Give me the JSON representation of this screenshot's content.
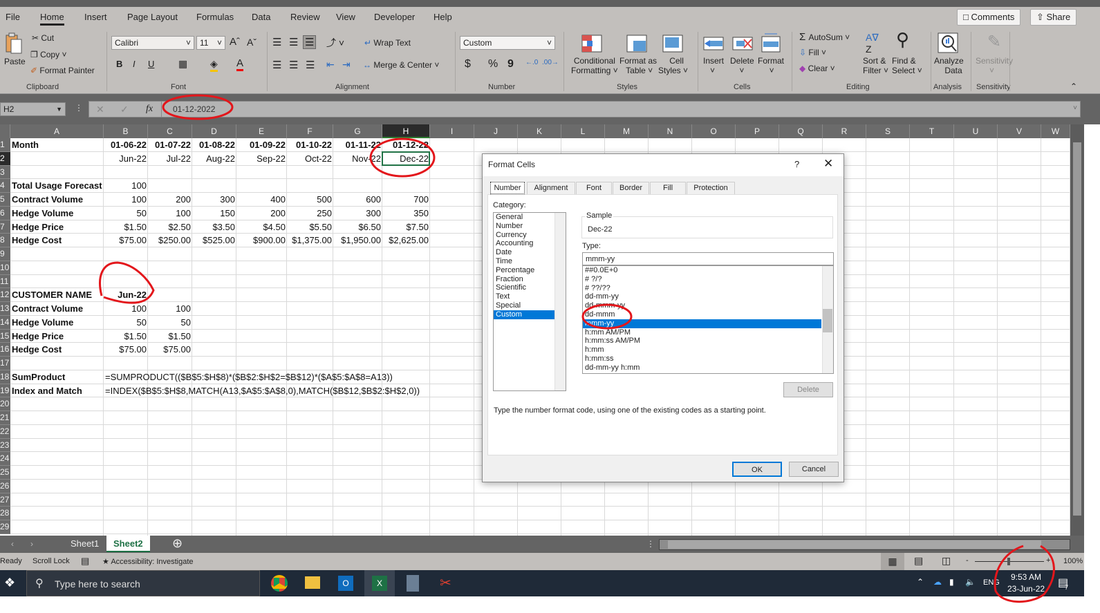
{
  "ribbon": {
    "tabs": [
      "File",
      "Home",
      "Insert",
      "Page Layout",
      "Formulas",
      "Data",
      "Review",
      "View",
      "Developer",
      "Help"
    ],
    "active_tab": "Home",
    "comments": "Comments",
    "share": "Share",
    "clipboard": {
      "paste": "Paste",
      "cut": "Cut",
      "copy": "Copy",
      "format_painter": "Format Painter",
      "group": "Clipboard"
    },
    "font": {
      "name": "Calibri",
      "size": "11",
      "bold": "B",
      "italic": "I",
      "underline": "U",
      "group": "Font"
    },
    "alignment": {
      "wrap": "Wrap Text",
      "merge": "Merge & Center",
      "group": "Alignment"
    },
    "number": {
      "format": "Custom",
      "currency": "$",
      "percent": "%",
      "comma": "9",
      "group": "Number"
    },
    "styles": {
      "conditional": "Conditional",
      "conditional2": "Formatting",
      "format_table": "Format as",
      "format_table2": "Table",
      "cell_styles": "Cell",
      "cell_styles2": "Styles",
      "group": "Styles"
    },
    "cells": {
      "insert": "Insert",
      "delete": "Delete",
      "format": "Format",
      "group": "Cells"
    },
    "editing": {
      "autosum": "AutoSum",
      "fill": "Fill",
      "clear": "Clear",
      "sort": "Sort &",
      "sort2": "Filter",
      "find": "Find &",
      "find2": "Select",
      "group": "Editing"
    },
    "analysis": {
      "analyze": "Analyze",
      "analyze2": "Data",
      "group": "Analysis"
    },
    "sensitivity": {
      "label": "Sensitivity",
      "group": "Sensitivity"
    }
  },
  "formula_bar": {
    "name_box": "H2",
    "value": "01-12-2022",
    "fx": "fx"
  },
  "grid": {
    "columns": [
      "A",
      "B",
      "C",
      "D",
      "E",
      "F",
      "G",
      "H",
      "I",
      "J",
      "K",
      "L",
      "M",
      "N",
      "O",
      "P",
      "Q",
      "R",
      "S",
      "T",
      "U",
      "V",
      "W"
    ],
    "rows": [
      "1",
      "2",
      "3",
      "4",
      "5",
      "6",
      "7",
      "8",
      "9",
      "10",
      "11",
      "12",
      "13",
      "14",
      "15",
      "16",
      "17",
      "18",
      "19",
      "20",
      "21",
      "22",
      "23",
      "24",
      "25",
      "26",
      "27",
      "28",
      "29"
    ],
    "selected": "H2",
    "cells": {
      "1": {
        "A": "Month",
        "B": "01-06-22",
        "C": "01-07-22",
        "D": "01-08-22",
        "E": "01-09-22",
        "F": "01-10-22",
        "G": "01-11-22",
        "H": "01-12-22"
      },
      "2": {
        "B": "Jun-22",
        "C": "Jul-22",
        "D": "Aug-22",
        "E": "Sep-22",
        "F": "Oct-22",
        "G": "Nov-22",
        "H": "Dec-22"
      },
      "4": {
        "A": "Total Usage Forecast",
        "B": "100"
      },
      "5": {
        "A": "Contract Volume",
        "B": "100",
        "C": "200",
        "D": "300",
        "E": "400",
        "F": "500",
        "G": "600",
        "H": "700"
      },
      "6": {
        "A": "Hedge Volume",
        "B": "50",
        "C": "100",
        "D": "150",
        "E": "200",
        "F": "250",
        "G": "300",
        "H": "350"
      },
      "7": {
        "A": "Hedge Price",
        "B": "$1.50",
        "C": "$2.50",
        "D": "$3.50",
        "E": "$4.50",
        "F": "$5.50",
        "G": "$6.50",
        "H": "$7.50"
      },
      "8": {
        "A": "Hedge Cost",
        "B": "$75.00",
        "C": "$250.00",
        "D": "$525.00",
        "E": "$900.00",
        "F": "$1,375.00",
        "G": "$1,950.00",
        "H": "$2,625.00"
      },
      "12": {
        "A": "CUSTOMER NAME",
        "B": "Jun-22"
      },
      "13": {
        "A": "Contract Volume",
        "B": "100",
        "C": "100"
      },
      "14": {
        "A": "Hedge Volume",
        "B": "50",
        "C": "50"
      },
      "15": {
        "A": "Hedge Price",
        "B": "$1.50",
        "C": "$1.50"
      },
      "16": {
        "A": "Hedge Cost",
        "B": "$75.00",
        "C": "$75.00"
      },
      "18": {
        "A": "SumProduct",
        "B": "=SUMPRODUCT(($B$5:$H$8)*($B$2:$H$2=$B$12)*($A$5:$A$8=A13))"
      },
      "19": {
        "A": "Index and Match",
        "B": "=INDEX($B$5:$H$8,MATCH(A13,$A$5:$A$8,0),MATCH($B$12,$B$2:$H$2,0))"
      }
    }
  },
  "sheets": {
    "tabs": [
      "Sheet1",
      "Sheet2"
    ],
    "active": "Sheet2"
  },
  "status": {
    "ready": "Ready",
    "scroll_lock": "Scroll Lock",
    "accessibility": "Accessibility: Investigate",
    "zoom": "100%"
  },
  "taskbar": {
    "search_placeholder": "Type here to search",
    "time": "9:53 AM",
    "date": "23-Jun-22",
    "lang": "ENG",
    "notifications": "7"
  },
  "dialog": {
    "title": "Format Cells",
    "help": "?",
    "tabs": [
      "Number",
      "Alignment",
      "Font",
      "Border",
      "Fill",
      "Protection"
    ],
    "active_tab": "Number",
    "category_label": "Category:",
    "categories": [
      "General",
      "Number",
      "Currency",
      "Accounting",
      "Date",
      "Time",
      "Percentage",
      "Fraction",
      "Scientific",
      "Text",
      "Special",
      "Custom"
    ],
    "selected_category": "Custom",
    "sample_label": "Sample",
    "sample_value": "Dec-22",
    "type_label": "Type:",
    "type_value": "mmm-yy",
    "types": [
      "##0.0E+0",
      "# ?/?",
      "# ??/??",
      "dd-mm-yy",
      "dd-mmm-yy",
      "dd-mmm",
      "mmm-yy",
      "h:mm AM/PM",
      "h:mm:ss AM/PM",
      "h:mm",
      "h:mm:ss",
      "dd-mm-yy h:mm"
    ],
    "selected_type": "mmm-yy",
    "delete": "Delete",
    "hint": "Type the number format code, using one of the existing codes as a starting point.",
    "ok": "OK",
    "cancel": "Cancel"
  },
  "colors": {
    "excel_green": "#217346",
    "selection_blue": "#0078d7",
    "annotation_red": "#e3161b"
  }
}
